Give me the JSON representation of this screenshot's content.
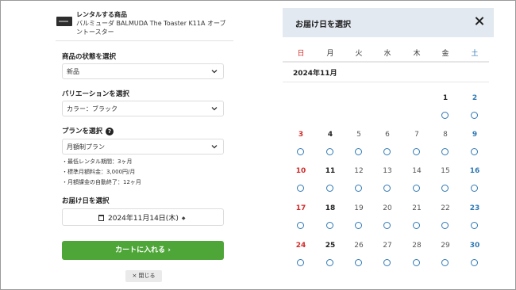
{
  "product": {
    "heading": "レンタルする商品",
    "name": "バルミューダ BALMUDA The Toaster K11A オーブントースター"
  },
  "condition": {
    "label": "商品の状態を選択",
    "value": "新品"
  },
  "variation": {
    "label": "バリエーションを選択",
    "value": "カラー：ブラック"
  },
  "plan": {
    "label": "プランを選択",
    "help": "?",
    "value": "月額制プラン",
    "notes": [
      "・最低レンタル期間：3ヶ月",
      "・標準月額料金：3,000円/月",
      "・月額課金の自動終了：12ヶ月"
    ]
  },
  "delivery": {
    "label": "お届け日を選択",
    "value": "2024年11月14日(木)"
  },
  "buttons": {
    "cart": "カートに入れる ›",
    "close": "× 閉じる"
  },
  "modal": {
    "title": "お届け日を選択",
    "weekdays": [
      "日",
      "月",
      "火",
      "水",
      "木",
      "金",
      "土"
    ],
    "month": "2024年11月",
    "weeks": [
      [
        "",
        "",
        "",
        "",
        "",
        "1",
        "2"
      ],
      [
        "3",
        "4",
        "5",
        "6",
        "7",
        "8",
        "9"
      ],
      [
        "10",
        "11",
        "12",
        "13",
        "14",
        "15",
        "16"
      ],
      [
        "17",
        "18",
        "19",
        "20",
        "21",
        "22",
        "23"
      ],
      [
        "24",
        "25",
        "26",
        "27",
        "28",
        "29",
        "30"
      ]
    ],
    "colors": {
      "sunday": "#d22b2b",
      "saturday": "#2f78b4",
      "available": "#2f78b4"
    }
  },
  "colors": {
    "accent": "#4ea638",
    "header_bg": "#e3e9f1"
  }
}
